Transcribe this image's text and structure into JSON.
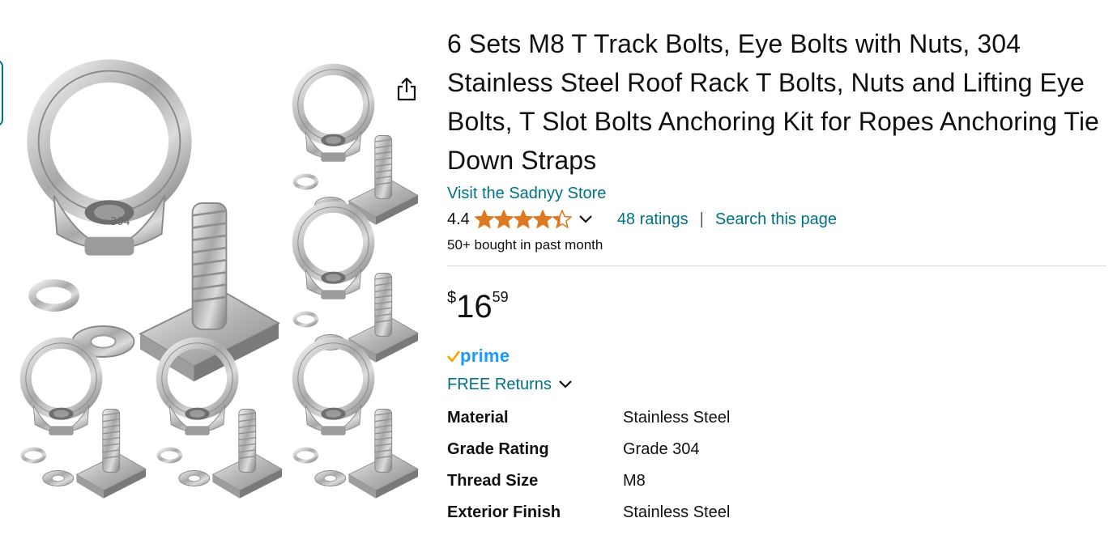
{
  "product": {
    "title": "6 Sets M8 T Track Bolts, Eye Bolts with Nuts, 304 Stainless Steel Roof Rack T Bolts, Nuts and Lifting Eye Bolts, T Slot Bolts Anchoring Kit for Ropes Anchoring Tie Down Straps",
    "store_link": "Visit the Sadnyy Store",
    "rating": "4.4",
    "rating_value": 4.4,
    "ratings_link": "48 ratings",
    "separator": "|",
    "search_link": "Search this page",
    "bought": "50+ bought in past month",
    "image_stamp": "304"
  },
  "price": {
    "symbol": "$",
    "whole": "16",
    "fraction": "59"
  },
  "prime": {
    "label": "prime"
  },
  "returns": {
    "label": "FREE Returns"
  },
  "specs": [
    {
      "key": "Material",
      "value": "Stainless Steel"
    },
    {
      "key": "Grade Rating",
      "value": "Grade 304"
    },
    {
      "key": "Thread Size",
      "value": "M8"
    },
    {
      "key": "Exterior Finish",
      "value": "Stainless Steel"
    }
  ],
  "colors": {
    "link": "#007185",
    "star": "#de7921",
    "prime_blue": "#1a98ff",
    "prime_check": "#f7a400",
    "divider": "#d5d9d9"
  },
  "icons": [
    "share-icon",
    "star-icon",
    "chevron-down-icon",
    "prime-check-icon"
  ]
}
